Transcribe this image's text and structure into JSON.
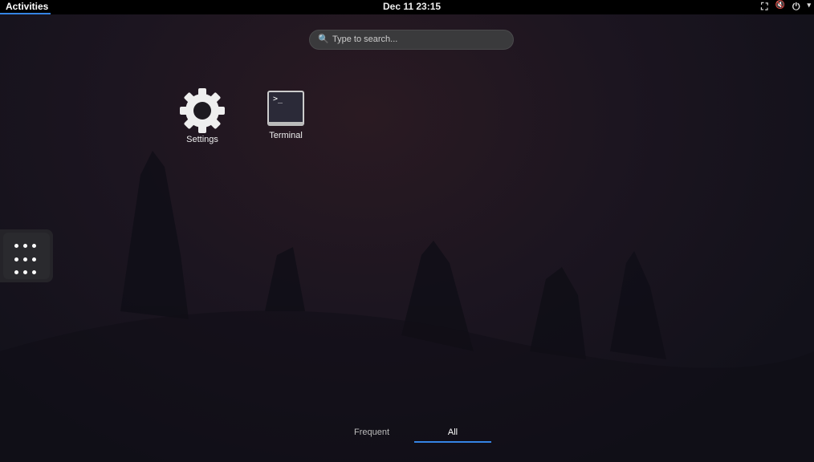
{
  "topbar": {
    "activities": "Activities",
    "clock": "Dec 11  23:15",
    "tray": {
      "network": "⛶",
      "volume": "🔇",
      "power": "⏻",
      "menu": "▾"
    }
  },
  "search": {
    "placeholder": "Type to search...",
    "icon": "🔍"
  },
  "apps": [
    {
      "label": "Settings",
      "icon": "gear-icon"
    },
    {
      "label": "Terminal",
      "icon": "terminal-icon",
      "glyph": ">_"
    }
  ],
  "tabs": [
    {
      "label": "Frequent"
    },
    {
      "label": "All",
      "active": true
    }
  ],
  "accent": "#3584e4"
}
